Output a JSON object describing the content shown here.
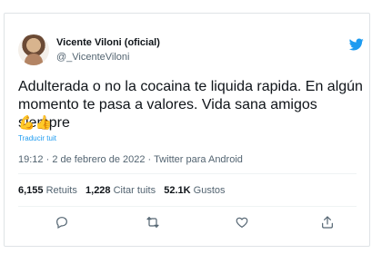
{
  "author": {
    "name": "Vicente Viloni (oficial)",
    "handle": "@_VicenteViloni"
  },
  "tweet": {
    "text": "Adulterada o no la cocaina te liquida rapida. En algún momento te pasa a valores. Vida sana amigos siempre",
    "emojis": "💪👍",
    "translate_label": "Traducir tuit",
    "time": "19:12",
    "date": "2 de febrero de 2022",
    "source": "Twitter para Android"
  },
  "stats": {
    "retweets_count": "6,155",
    "retweets_label": "Retuits",
    "quotes_count": "1,228",
    "quotes_label": "Citar tuits",
    "likes_count": "52.1K",
    "likes_label": "Gustos"
  },
  "icons": {
    "brand": "twitter-bird-icon",
    "reply": "reply-icon",
    "retweet": "retweet-icon",
    "like": "heart-icon",
    "share": "share-icon"
  },
  "colors": {
    "twitter_blue": "#1d9bf0",
    "text": "#0f1419",
    "muted": "#536471"
  }
}
